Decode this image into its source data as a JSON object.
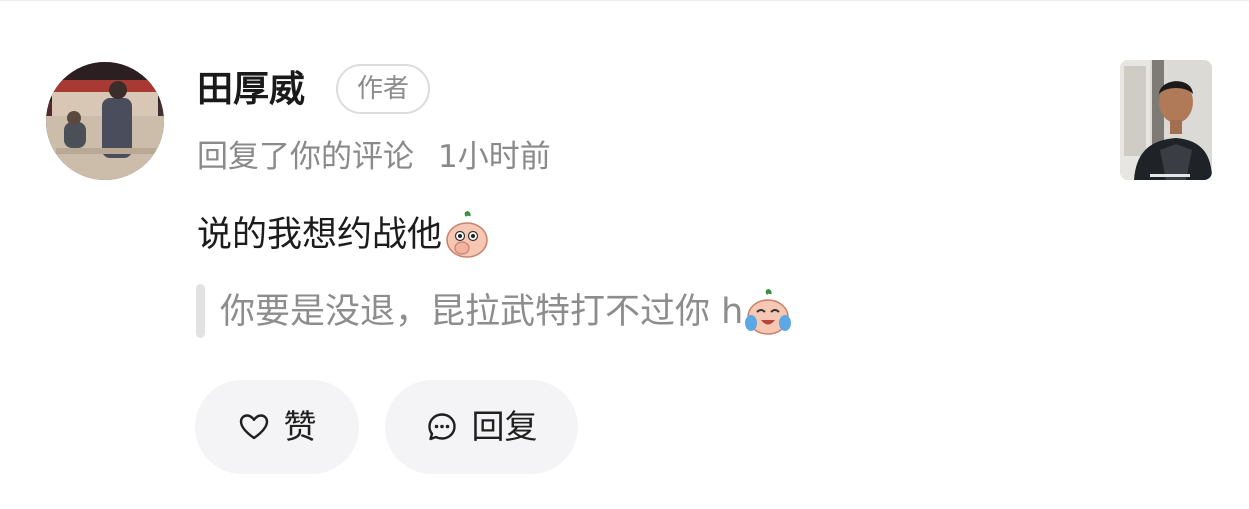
{
  "comment": {
    "username": "田厚威",
    "author_badge": "作者",
    "action_text": "回复了你的评论",
    "time": "1小时前",
    "reply_text": "说的我想约战他",
    "reply_emoji": "covering-mouth-emoji",
    "quoted_text": "你要是没退，昆拉武特打不过你 h",
    "quoted_emoji": "crying-laughing-emoji"
  },
  "actions": {
    "like_label": "赞",
    "like_icon": "heart-icon",
    "reply_label": "回复",
    "reply_icon": "speech-bubble-icon"
  },
  "colors": {
    "primary_text": "#1b1b1b",
    "secondary_text": "#8a8a8a",
    "button_bg": "#f4f4f6",
    "badge_border": "#dcdcdc"
  }
}
